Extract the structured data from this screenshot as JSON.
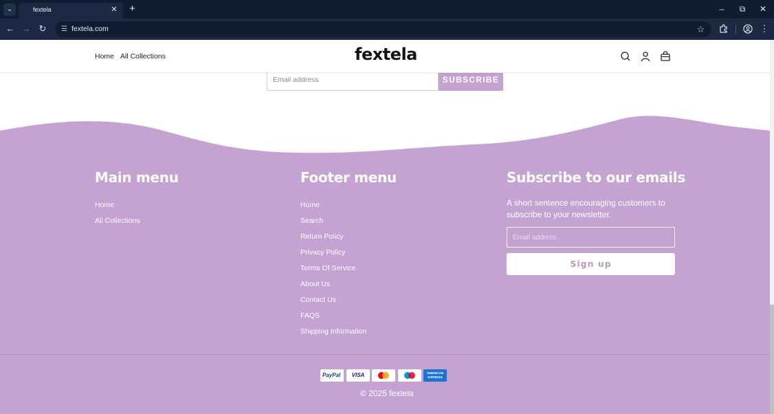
{
  "browser": {
    "tab_title": "fextela",
    "url": "fextela.com"
  },
  "header": {
    "nav": [
      "Home",
      "All Collections"
    ],
    "logo": "fextela"
  },
  "top_signup": {
    "email_placeholder": "Email address",
    "button_label": "SUBSCRIBE"
  },
  "footer": {
    "background": "#c4a2d1",
    "main_menu": {
      "heading": "Main menu",
      "links": [
        "Home",
        "All Collections"
      ]
    },
    "footer_menu": {
      "heading": "Footer menu",
      "links": [
        "Home",
        "Search",
        "Return Policy",
        "Privacy Policy",
        "Terms Of Service",
        "About Us",
        "Contact Us",
        "FAQS",
        "Shipping Information"
      ]
    },
    "subscribe": {
      "heading": "Subscribe to our emails",
      "text": "A short sentence encouraging customers to subscribe to your newsletter.",
      "email_placeholder": "Email address",
      "button_label": "Sign up"
    },
    "payment_icons": [
      "paypal-icon",
      "visa-icon",
      "mastercard-icon",
      "maestro-icon",
      "american-express-icon"
    ],
    "payment_labels": {
      "paypal": "PayPal",
      "visa": "VISA",
      "amex": "AMERICAN EXPRESS"
    },
    "copyright": "© 2025 fextela"
  }
}
